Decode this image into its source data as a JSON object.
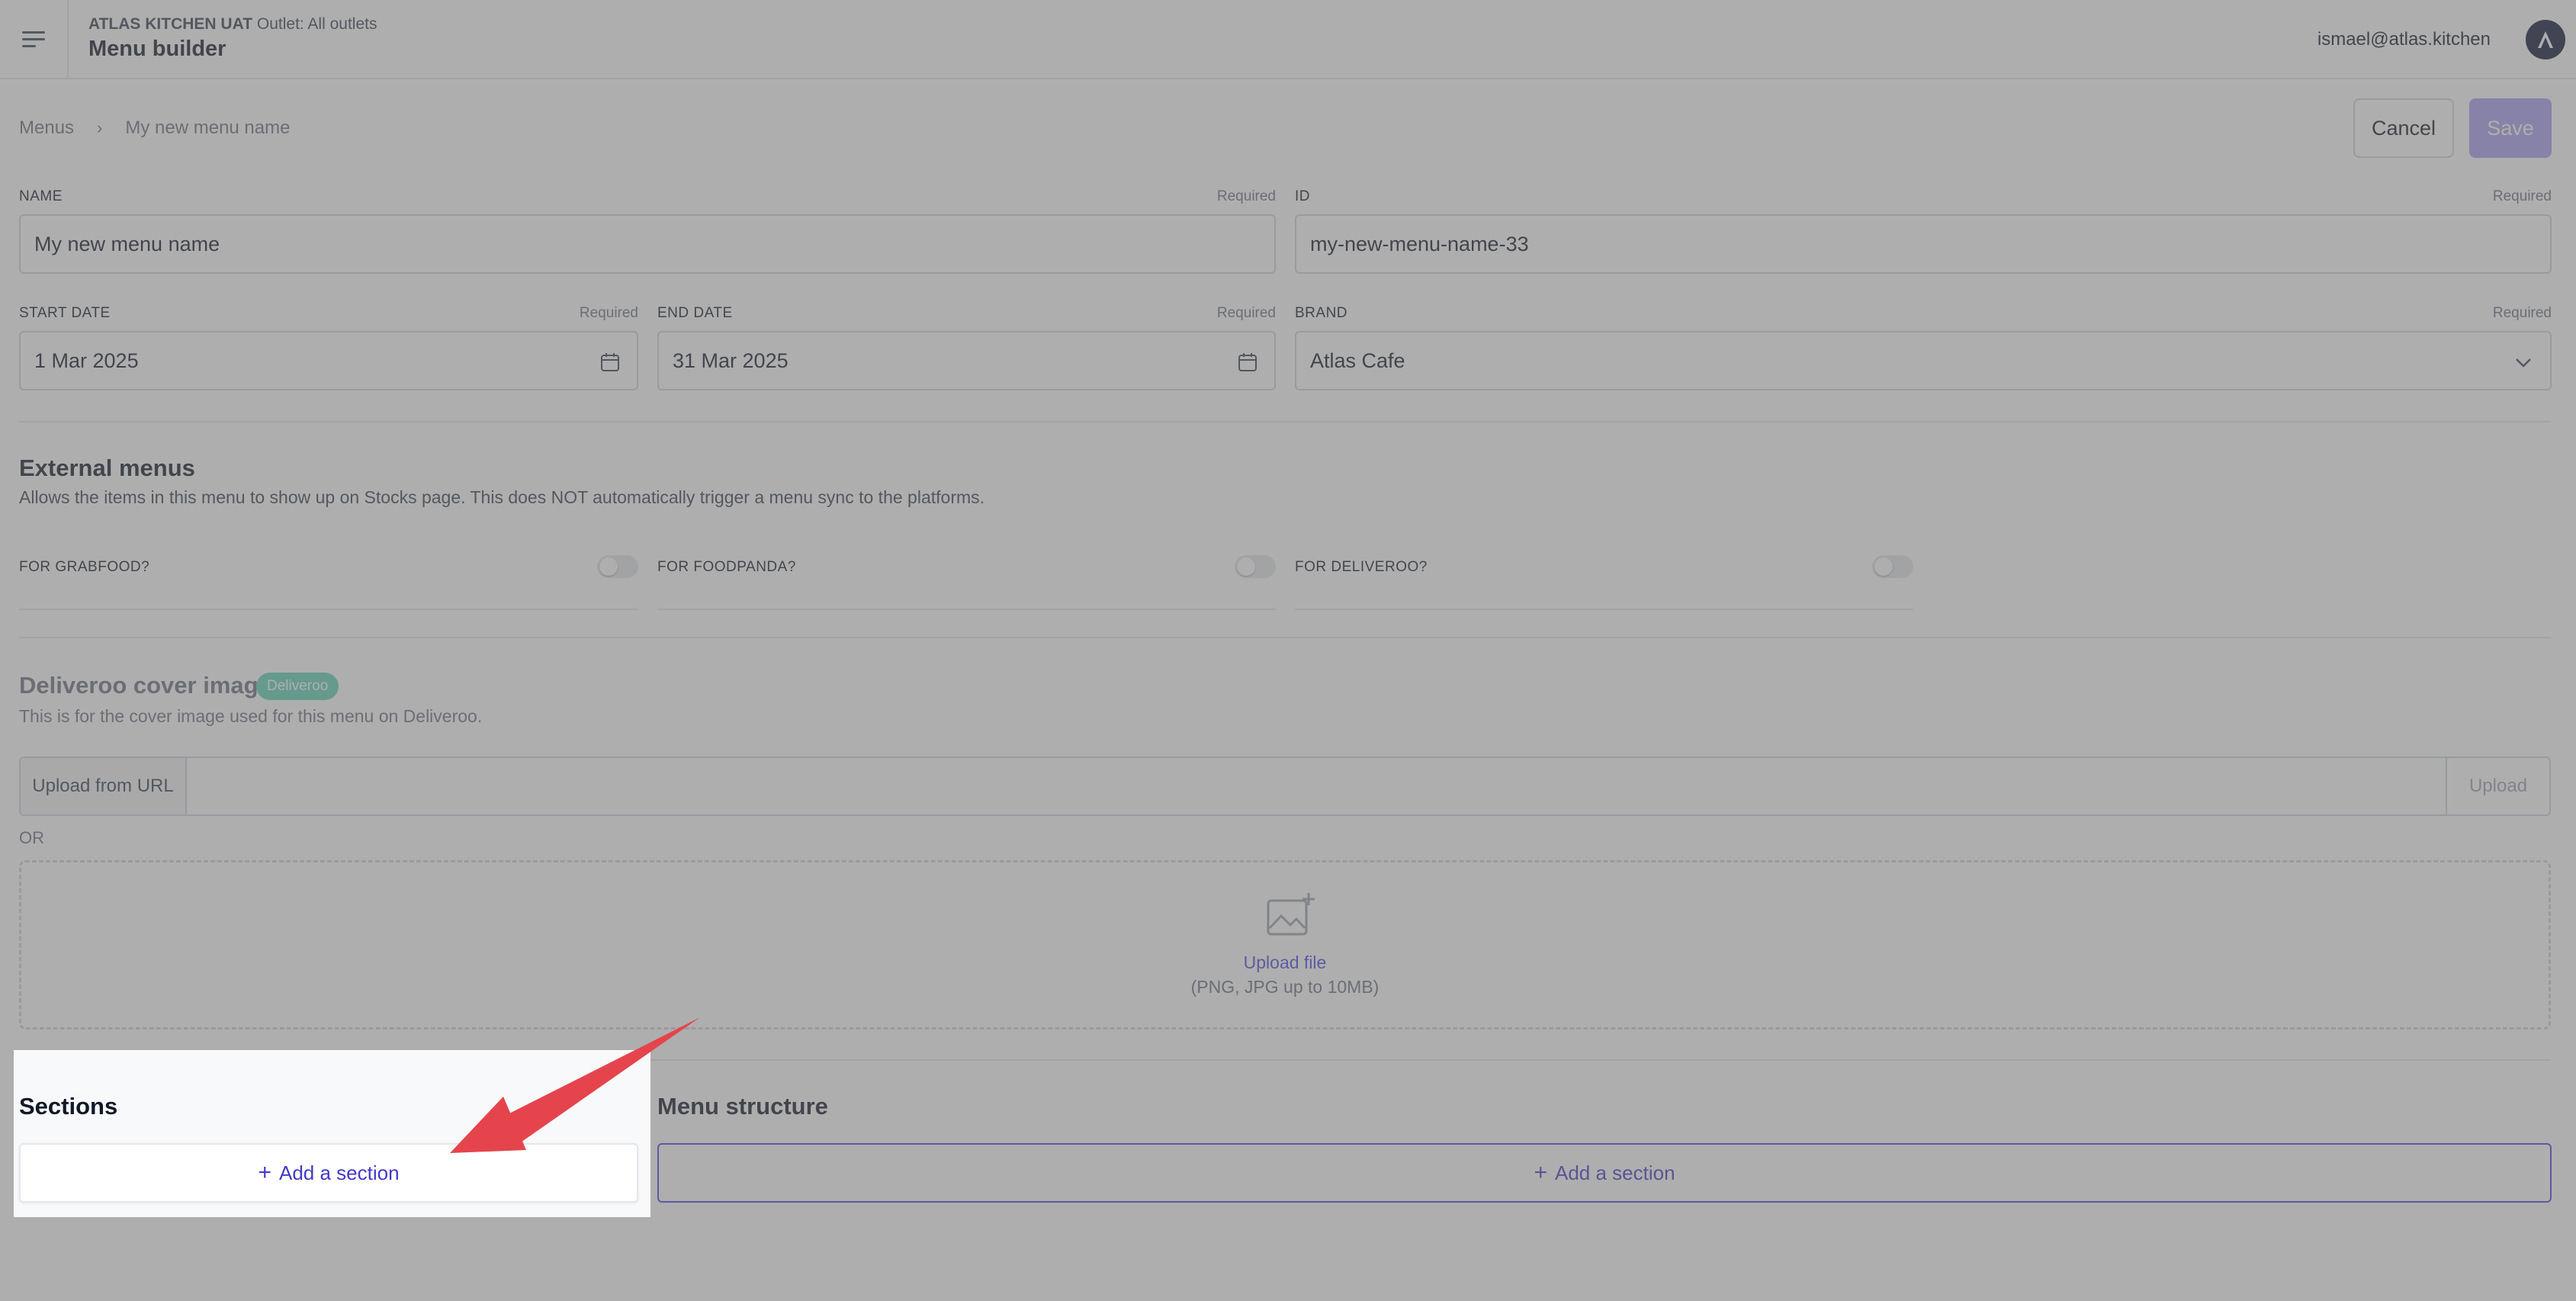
{
  "header": {
    "org_name": "ATLAS KITCHEN UAT",
    "outlet": "Outlet: All outlets",
    "title": "Menu builder",
    "user_email": "ismael@atlas.kitchen"
  },
  "breadcrumb": {
    "root": "Menus",
    "current": "My new menu name"
  },
  "actions": {
    "cancel_label": "Cancel",
    "save_label": "Save"
  },
  "fields": {
    "name": {
      "label": "NAME",
      "required": "Required",
      "value": "My new menu name"
    },
    "id": {
      "label": "ID",
      "required": "Required",
      "value": "my-new-menu-name-33"
    },
    "start_date": {
      "label": "START DATE",
      "required": "Required",
      "value": "1 Mar 2025"
    },
    "end_date": {
      "label": "END DATE",
      "required": "Required",
      "value": "31 Mar 2025"
    },
    "brand": {
      "label": "BRAND",
      "required": "Required",
      "value": "Atlas Cafe"
    }
  },
  "external_menus": {
    "title": "External menus",
    "description": "Allows the items in this menu to show up on Stocks page. This does NOT automatically trigger a menu sync to the platforms.",
    "toggles": [
      {
        "label": "FOR GRABFOOD?",
        "on": false
      },
      {
        "label": "FOR FOODPANDA?",
        "on": false
      },
      {
        "label": "FOR DELIVEROO?",
        "on": false
      }
    ]
  },
  "cover_image": {
    "title": "Deliveroo cover image",
    "badge": "Deliveroo",
    "description": "This is for the cover image used for this menu on Deliveroo.",
    "url_prefix": "Upload from URL",
    "url_value": "",
    "upload_button": "Upload",
    "or_text": "OR",
    "upload_link": "Upload file",
    "upload_hint": "(PNG, JPG up to 10MB)"
  },
  "sections": {
    "title": "Sections",
    "add_label": "Add a section"
  },
  "menu_structure": {
    "title": "Menu structure",
    "add_label": "Add a section"
  },
  "colors": {
    "accent": "#4f46e5",
    "save_disabled": "#a99ef0",
    "badge": "#5fd3b7",
    "annotation_arrow": "#e5444d"
  }
}
